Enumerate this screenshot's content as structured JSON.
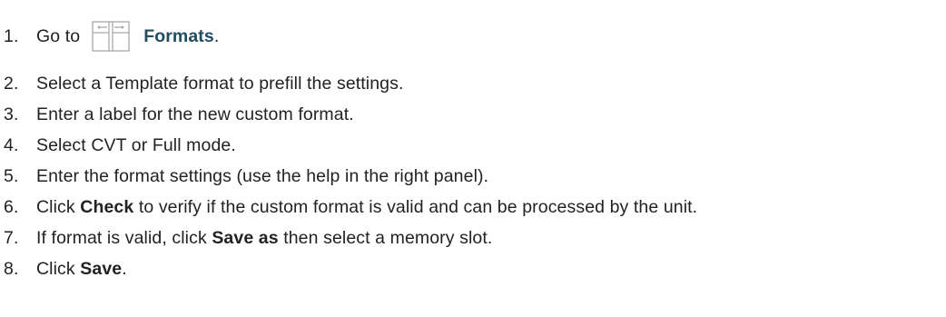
{
  "steps": [
    {
      "num": "1.",
      "before": "Go to",
      "icon": "formats-icon",
      "link": "Formats",
      "after": "."
    },
    {
      "num": "2.",
      "text": "Select a Template format to prefill the settings."
    },
    {
      "num": "3.",
      "text": "Enter a label for the new custom format."
    },
    {
      "num": "4.",
      "text": "Select CVT or Full mode."
    },
    {
      "num": "5.",
      "text": "Enter the format settings (use the help in the right panel)."
    },
    {
      "num": "6.",
      "before": "Click",
      "bold": "Check",
      "after": "to verify if the custom format is valid and can be processed by the unit."
    },
    {
      "num": "7.",
      "before": "If format is valid, click",
      "bold": "Save as",
      "after": "then select a memory slot."
    },
    {
      "num": "8.",
      "before": "Click",
      "bold": "Save",
      "after": "."
    }
  ],
  "colors": {
    "link": "#1f4e63",
    "text": "#222222",
    "icon": "#a9a9a9"
  }
}
